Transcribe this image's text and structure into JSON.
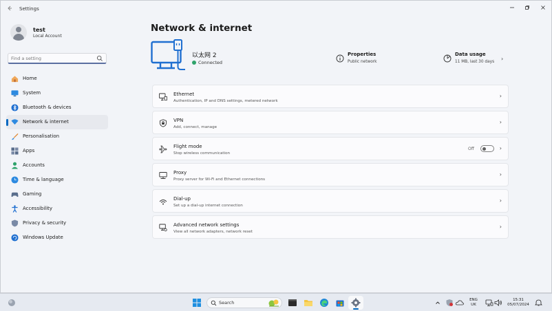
{
  "window": {
    "title": "Settings"
  },
  "profile": {
    "name": "test",
    "subtitle": "Local Account"
  },
  "search": {
    "placeholder": "Find a setting"
  },
  "nav": {
    "items": [
      {
        "label": "Home",
        "icon": "home-icon"
      },
      {
        "label": "System",
        "icon": "monitor-icon"
      },
      {
        "label": "Bluetooth & devices",
        "icon": "bluetooth-icon"
      },
      {
        "label": "Network & internet",
        "icon": "wifi-icon",
        "active": true
      },
      {
        "label": "Personalisation",
        "icon": "brush-icon"
      },
      {
        "label": "Apps",
        "icon": "apps-icon"
      },
      {
        "label": "Accounts",
        "icon": "person-icon"
      },
      {
        "label": "Time & language",
        "icon": "globe-clock-icon"
      },
      {
        "label": "Gaming",
        "icon": "gamepad-icon"
      },
      {
        "label": "Accessibility",
        "icon": "accessibility-icon"
      },
      {
        "label": "Privacy & security",
        "icon": "shield-icon"
      },
      {
        "label": "Windows Update",
        "icon": "update-icon"
      }
    ]
  },
  "main": {
    "title": "Network & internet",
    "connection": {
      "name": "以太网 2",
      "status": "Connected"
    },
    "properties": {
      "title": "Properties",
      "subtitle": "Public network"
    },
    "data_usage": {
      "title": "Data usage",
      "subtitle": "11 MB, last 30 days"
    },
    "cards": [
      {
        "title": "Ethernet",
        "subtitle": "Authentication, IP and DNS settings, metered network",
        "icon": "ethernet-icon"
      },
      {
        "title": "VPN",
        "subtitle": "Add, connect, manage",
        "icon": "vpn-shield-icon"
      },
      {
        "title": "Flight mode",
        "subtitle": "Stop wireless communication",
        "icon": "airplane-icon",
        "toggle_label": "Off"
      },
      {
        "title": "Proxy",
        "subtitle": "Proxy server for Wi-Fi and Ethernet connections",
        "icon": "proxy-icon"
      },
      {
        "title": "Dial-up",
        "subtitle": "Set up a dial-up internet connection",
        "icon": "dialup-icon"
      },
      {
        "title": "Advanced network settings",
        "subtitle": "View all network adapters, network reset",
        "icon": "advanced-network-icon"
      }
    ]
  },
  "taskbar": {
    "search_label": "Search",
    "language": {
      "line1": "ENG",
      "line2": "UK"
    },
    "clock": {
      "time": "15:31",
      "date": "05/07/2024"
    }
  },
  "colors": {
    "accent": "#0067c0",
    "connected": "#2fa36b",
    "hero_icon": "#1f6fd0"
  }
}
